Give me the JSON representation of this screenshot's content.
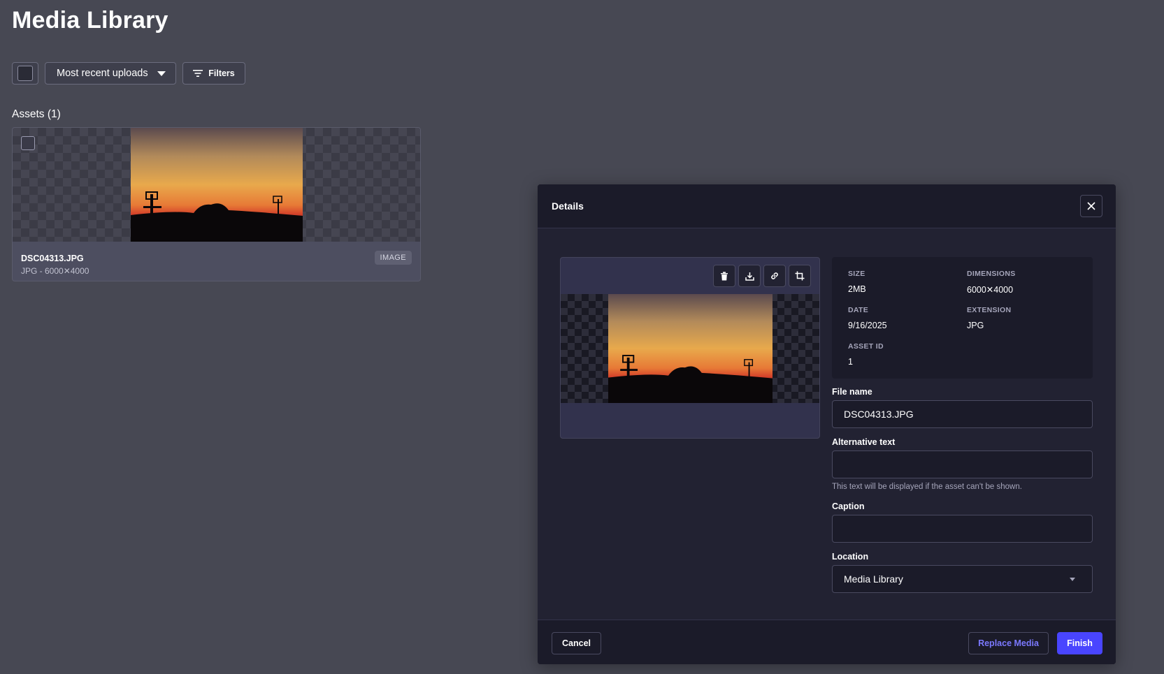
{
  "page": {
    "title": "Media Library"
  },
  "toolbar": {
    "sort_label": "Most recent uploads",
    "filters_label": "Filters"
  },
  "assets": {
    "heading": "Assets (1)",
    "items": [
      {
        "name": "DSC04313.JPG",
        "subtitle": "JPG - 6000✕4000",
        "type": "IMAGE"
      }
    ]
  },
  "modal": {
    "title": "Details",
    "info": {
      "size_label": "SIZE",
      "size_value": "2MB",
      "dimensions_label": "DIMENSIONS",
      "dimensions_value": "6000✕4000",
      "date_label": "DATE",
      "date_value": "9/16/2025",
      "extension_label": "EXTENSION",
      "extension_value": "JPG",
      "asset_id_label": "ASSET ID",
      "asset_id_value": "1"
    },
    "fields": {
      "file_name_label": "File name",
      "file_name_value": "DSC04313.JPG",
      "alt_text_label": "Alternative text",
      "alt_text_value": "",
      "alt_text_hint": "This text will be displayed if the asset can't be shown.",
      "caption_label": "Caption",
      "caption_value": "",
      "location_label": "Location",
      "location_value": "Media Library"
    },
    "footer": {
      "cancel_label": "Cancel",
      "replace_label": "Replace Media",
      "finish_label": "Finish"
    }
  },
  "colors": {
    "page_bg": "#474853",
    "modal_bg": "#222232",
    "primary": "#4945ff",
    "primary_text": "#7b79ff"
  },
  "icons": {
    "preview_actions": [
      "trash-icon",
      "download-icon",
      "link-icon",
      "crop-icon"
    ],
    "close": "close-icon",
    "filter": "filter-icon",
    "sort_caret": "caret-down-icon"
  }
}
